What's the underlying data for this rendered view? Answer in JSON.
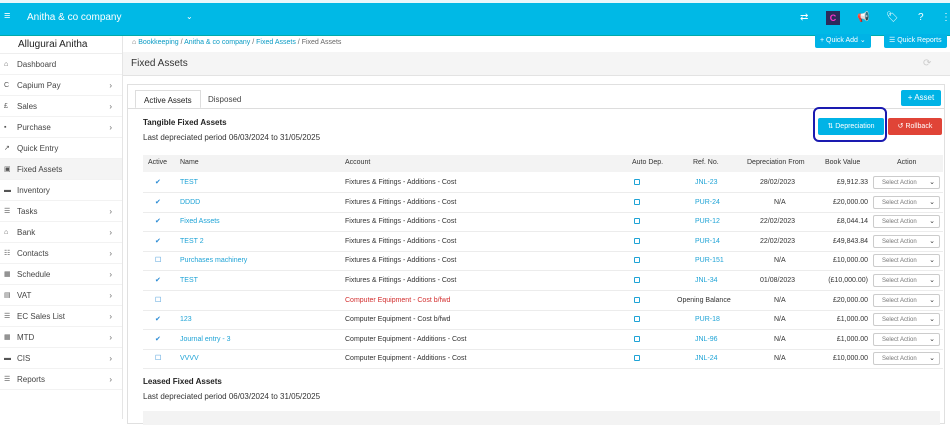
{
  "header": {
    "company": "Anitha & co company",
    "caret": "⌄",
    "menu_icon": "≡",
    "icons": [
      "⇄",
      "C",
      "📢",
      "🏷",
      "?",
      "⋮"
    ]
  },
  "sidebar": {
    "user": "Allugurai Anitha",
    "items": [
      {
        "label": "Dashboard",
        "icon": "⌂",
        "chevron": ""
      },
      {
        "label": "Capium Pay",
        "icon": "C",
        "chevron": "›"
      },
      {
        "label": "Sales",
        "icon": "£",
        "chevron": "›"
      },
      {
        "label": "Purchase",
        "icon": "▪",
        "chevron": "›"
      },
      {
        "label": "Quick Entry",
        "icon": "↗",
        "chevron": ""
      },
      {
        "label": "Fixed Assets",
        "icon": "▣",
        "chevron": ""
      },
      {
        "label": "Inventory",
        "icon": "▬",
        "chevron": ""
      },
      {
        "label": "Tasks",
        "icon": "☰",
        "chevron": "›"
      },
      {
        "label": "Bank",
        "icon": "⌂",
        "chevron": "›"
      },
      {
        "label": "Contacts",
        "icon": "☷",
        "chevron": "›"
      },
      {
        "label": "Schedule",
        "icon": "▦",
        "chevron": "›"
      },
      {
        "label": "VAT",
        "icon": "▤",
        "chevron": "›"
      },
      {
        "label": "EC Sales List",
        "icon": "☰",
        "chevron": "›"
      },
      {
        "label": "MTD",
        "icon": "▦",
        "chevron": "›"
      },
      {
        "label": "CIS",
        "icon": "▬",
        "chevron": "›"
      },
      {
        "label": "Reports",
        "icon": "☰",
        "chevron": "›"
      }
    ]
  },
  "breadcrumb": {
    "items": [
      "Bookkeeping",
      "Anitha & co company",
      "Fixed Assets"
    ],
    "current": "Fixed Assets",
    "sep": "/"
  },
  "buttons": {
    "quick_add": "+ Quick Add ⌄",
    "quick_reports": "☰ Quick Reports",
    "add_asset": "+ Asset",
    "depreciation": "⇅ Depreciation",
    "rollback": "↺ Rollback"
  },
  "page": {
    "title": "Fixed Assets"
  },
  "tabs": {
    "active": "Active Assets",
    "disposed": "Disposed"
  },
  "tangible": {
    "title": "Tangible Fixed Assets",
    "period": "Last depreciated period 06/03/2024 to 31/05/2025"
  },
  "leased": {
    "title": "Leased Fixed Assets",
    "period": "Last depreciated period 06/03/2024 to 31/05/2025"
  },
  "table": {
    "headers": {
      "active": "Active",
      "name": "Name",
      "account": "Account",
      "auto_dep": "Auto Dep.",
      "ref": "Ref. No.",
      "dep_from": "Depreciation From",
      "book_value": "Book Value",
      "action": "Action"
    },
    "select_placeholder": "Select Action",
    "rows": [
      {
        "checked": "✔",
        "name": "TEST",
        "account": "Fixtures & Fittings - Additions - Cost",
        "ref": "JNL-23",
        "dep_from": "28/02/2023",
        "book_value": "£9,912.33",
        "red": false
      },
      {
        "checked": "✔",
        "name": "DDDD",
        "account": "Fixtures & Fittings - Additions - Cost",
        "ref": "PUR-24",
        "dep_from": "N/A",
        "book_value": "£20,000.00",
        "red": false
      },
      {
        "checked": "✔",
        "name": "Fixed Assets",
        "account": "Fixtures & Fittings - Additions - Cost",
        "ref": "PUR-12",
        "dep_from": "22/02/2023",
        "book_value": "£8,044.14",
        "red": false
      },
      {
        "checked": "✔",
        "name": "TEST 2",
        "account": "Fixtures & Fittings - Additions - Cost",
        "ref": "PUR-14",
        "dep_from": "22/02/2023",
        "book_value": "£49,843.84",
        "red": false
      },
      {
        "checked": "☐",
        "name": "Purchases machinery",
        "account": "Fixtures & Fittings - Additions - Cost",
        "ref": "PUR-151",
        "dep_from": "N/A",
        "book_value": "£10,000.00",
        "red": false
      },
      {
        "checked": "✔",
        "name": "TEST",
        "account": "Fixtures & Fittings - Additions - Cost",
        "ref": "JNL-34",
        "dep_from": "01/08/2023",
        "book_value": "(£10,000.00)",
        "red": false
      },
      {
        "checked": "☐",
        "name": "",
        "account": "Computer Equipment - Cost b/fwd",
        "ref": "Opening Balance",
        "dep_from": "N/A",
        "book_value": "£20,000.00",
        "red": true
      },
      {
        "checked": "✔",
        "name": "123",
        "account": "Computer Equipment - Cost b/fwd",
        "ref": "PUR-18",
        "dep_from": "N/A",
        "book_value": "£1,000.00",
        "red": false
      },
      {
        "checked": "✔",
        "name": "Journal entry - 3",
        "account": "Computer Equipment - Additions - Cost",
        "ref": "JNL-96",
        "dep_from": "N/A",
        "book_value": "£1,000.00",
        "red": false
      },
      {
        "checked": "☐",
        "name": "VVVV",
        "account": "Computer Equipment - Additions - Cost",
        "ref": "JNL-24",
        "dep_from": "N/A",
        "book_value": "£10,000.00",
        "red": false
      }
    ]
  }
}
